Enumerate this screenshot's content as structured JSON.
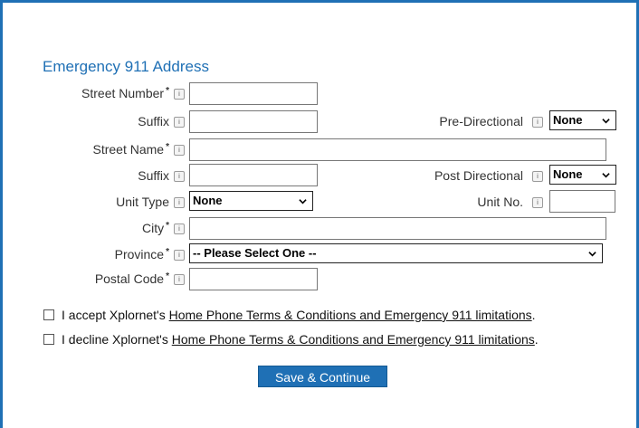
{
  "form": {
    "title": "Emergency 911 Address",
    "required_marker": "*",
    "info_glyph": "i",
    "fields": {
      "street_number": {
        "label": "Street Number",
        "value": ""
      },
      "suffix_1": {
        "label": "Suffix",
        "value": ""
      },
      "pre_directional": {
        "label": "Pre-Directional",
        "value": "None"
      },
      "street_name": {
        "label": "Street Name",
        "value": ""
      },
      "suffix_2": {
        "label": "Suffix",
        "value": ""
      },
      "post_directional": {
        "label": "Post Directional",
        "value": "None"
      },
      "unit_type": {
        "label": "Unit Type",
        "value": "None"
      },
      "unit_no": {
        "label": "Unit No.",
        "value": ""
      },
      "city": {
        "label": "City",
        "value": ""
      },
      "province": {
        "label": "Province",
        "value": "-- Please Select One --"
      },
      "postal_code": {
        "label": "Postal Code",
        "value": ""
      }
    }
  },
  "terms": {
    "accept_prefix": "I accept Xplornet's ",
    "decline_prefix": "I decline Xplornet's ",
    "link_text": "Home Phone Terms & Conditions and Emergency 911 limitations",
    "suffix": "."
  },
  "actions": {
    "save_label": "Save & Continue"
  },
  "colors": {
    "accent": "#1f70b5"
  },
  "icons": {
    "info": "info-icon",
    "dropdown": "chevron-down-icon"
  }
}
